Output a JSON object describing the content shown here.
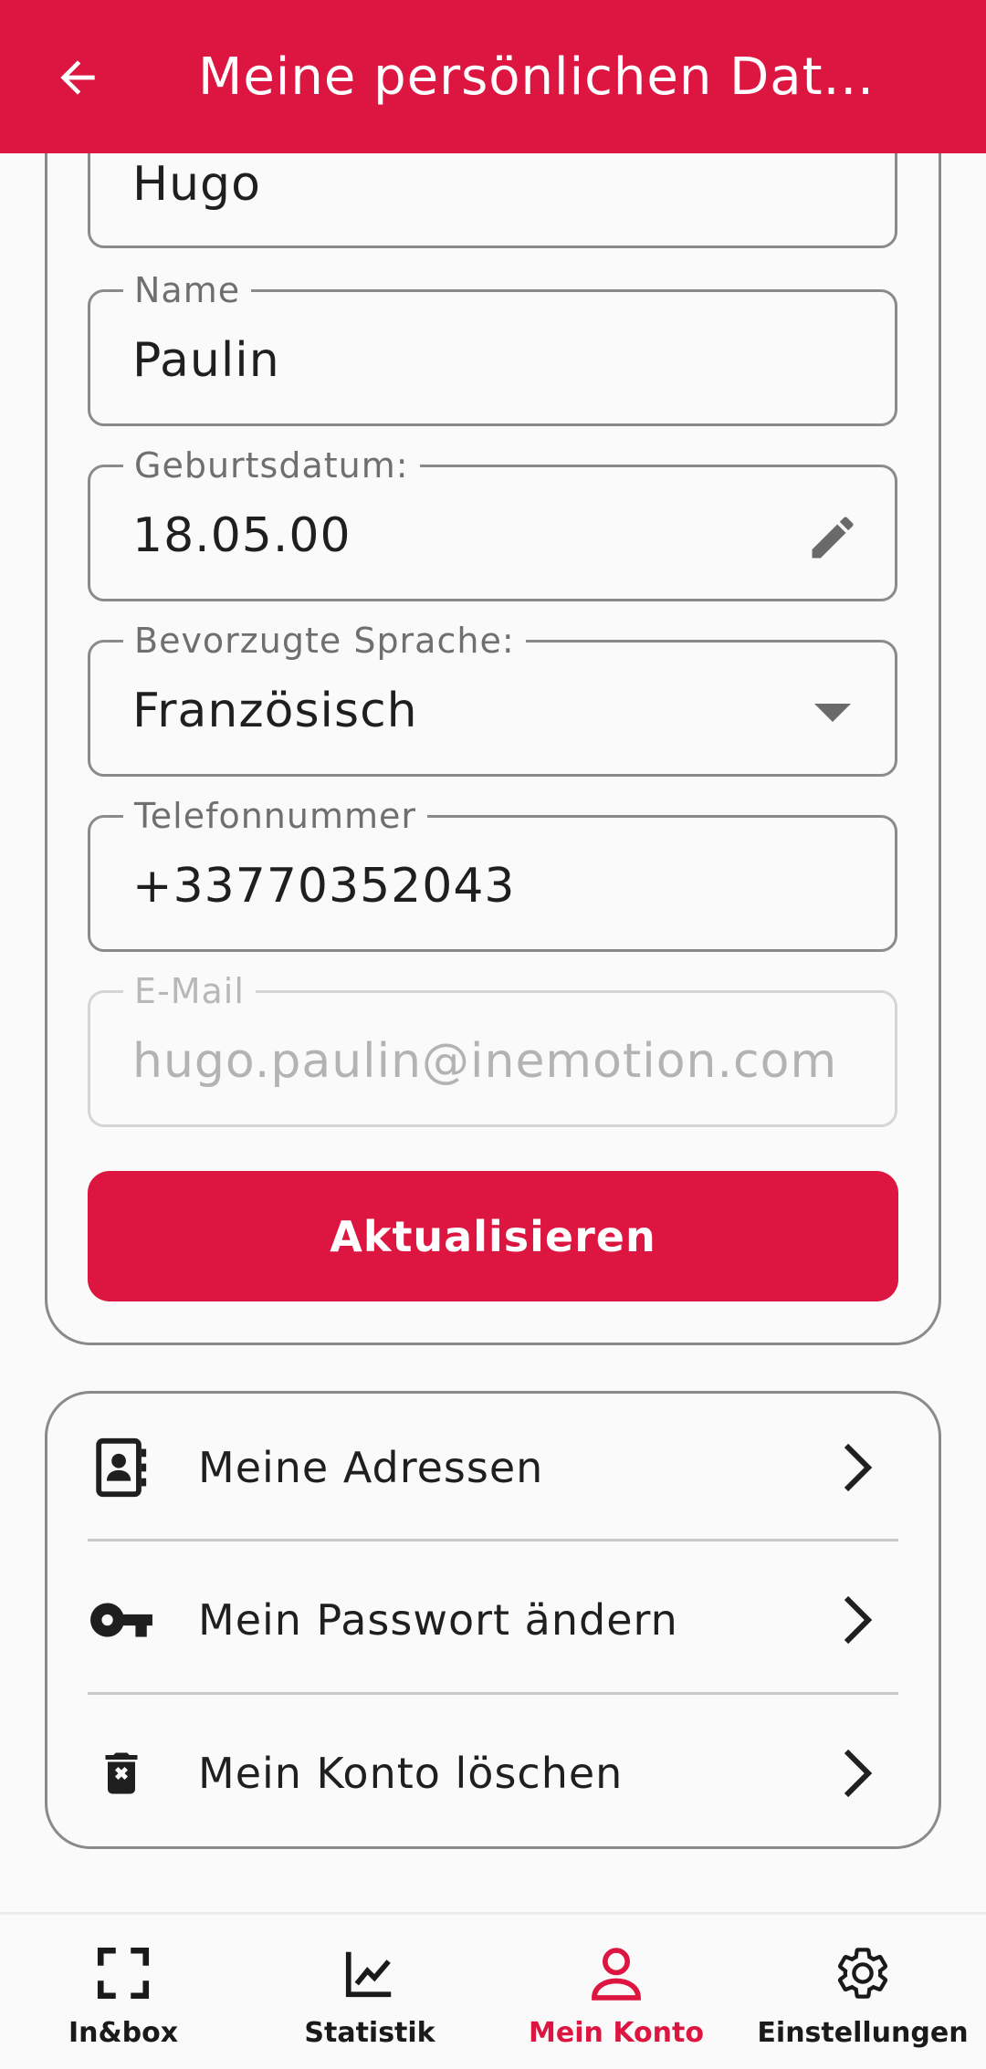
{
  "colors": {
    "accent": "#dc1640",
    "text": "#1f1f1f",
    "muted": "#6f6f6f",
    "disabled": "#b3b3b3"
  },
  "appbar": {
    "title": "Meine persönlichen Dat...",
    "back_icon": "arrow-left-icon"
  },
  "form": {
    "firstname": {
      "label": "",
      "value": "Hugo"
    },
    "name": {
      "label": "Name",
      "value": "Paulin"
    },
    "birthdate": {
      "label": "Geburtsdatum:",
      "value": "18.05.00",
      "icon": "pencil-icon"
    },
    "language": {
      "label": "Bevorzugte Sprache:",
      "value": "Französisch",
      "icon": "dropdown-arrow-icon"
    },
    "phone": {
      "label": "Telefonnummer",
      "value": "+33770352043"
    },
    "email": {
      "label": "E-Mail",
      "value": "hugo.paulin@inemotion.com",
      "disabled": true
    },
    "update_button": "Aktualisieren"
  },
  "account_menu": [
    {
      "label": "Meine Adressen",
      "icon": "contacts-book-icon"
    },
    {
      "label": "Mein Passwort ändern",
      "icon": "key-icon"
    },
    {
      "label": "Mein Konto löschen",
      "icon": "delete-icon"
    }
  ],
  "bottom_nav": [
    {
      "label": "In&box",
      "icon": "scan-frame-icon",
      "active": false
    },
    {
      "label": "Statistik",
      "icon": "chart-icon",
      "active": false
    },
    {
      "label": "Mein Konto",
      "icon": "person-icon",
      "active": true
    },
    {
      "label": "Einstellungen",
      "icon": "gear-icon",
      "active": false
    }
  ]
}
